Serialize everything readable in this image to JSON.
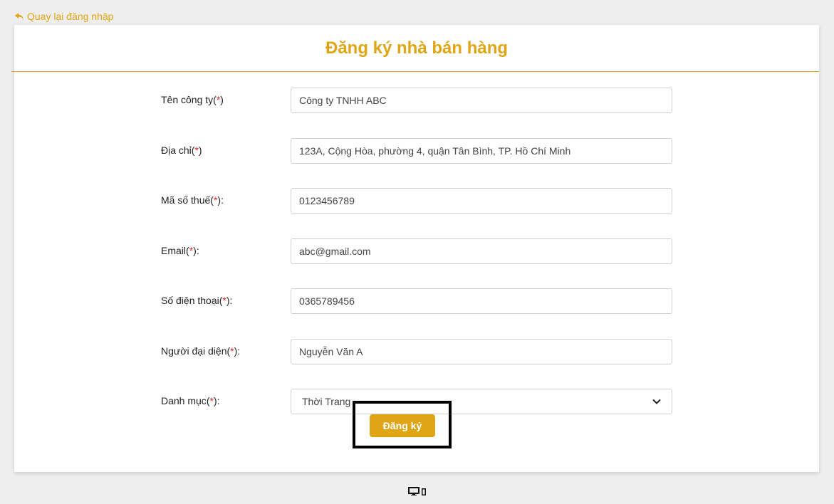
{
  "back_link": {
    "label": "Quay lại đăng nhập"
  },
  "page": {
    "title": "Đăng ký nhà bán hàng"
  },
  "form": {
    "fields": [
      {
        "label": "Tên công ty",
        "required_mark": "*",
        "suffix": "",
        "value": "Công ty TNHH ABC"
      },
      {
        "label": "Địa chỉ",
        "required_mark": "*",
        "suffix": "",
        "value": "123A, Cộng Hòa, phường 4, quận Tân Bình, TP. Hồ Chí Minh"
      },
      {
        "label": "Mã số thuế",
        "required_mark": "*",
        "suffix": ":",
        "value": "0123456789"
      },
      {
        "label": "Email",
        "required_mark": "*",
        "suffix": ":",
        "value": "abc@gmail.com"
      },
      {
        "label": "Số điện thoại",
        "required_mark": "*",
        "suffix": ":",
        "value": "0365789456"
      },
      {
        "label": "Người đại diện",
        "required_mark": "*",
        "suffix": ":",
        "value": "Nguyễn Văn A"
      }
    ],
    "category": {
      "label": "Danh mục",
      "required_mark": "*",
      "suffix": ":",
      "selected": "Thời Trang"
    },
    "submit_label": "Đăng ký"
  },
  "colors": {
    "accent": "#e0a514",
    "required": "#e02020",
    "background": "#eeeeee"
  },
  "icons": {
    "back": "reply-arrow-icon",
    "select": "chevron-down-icon",
    "desktop": "desktop-icon",
    "mobile": "mobile-icon"
  }
}
